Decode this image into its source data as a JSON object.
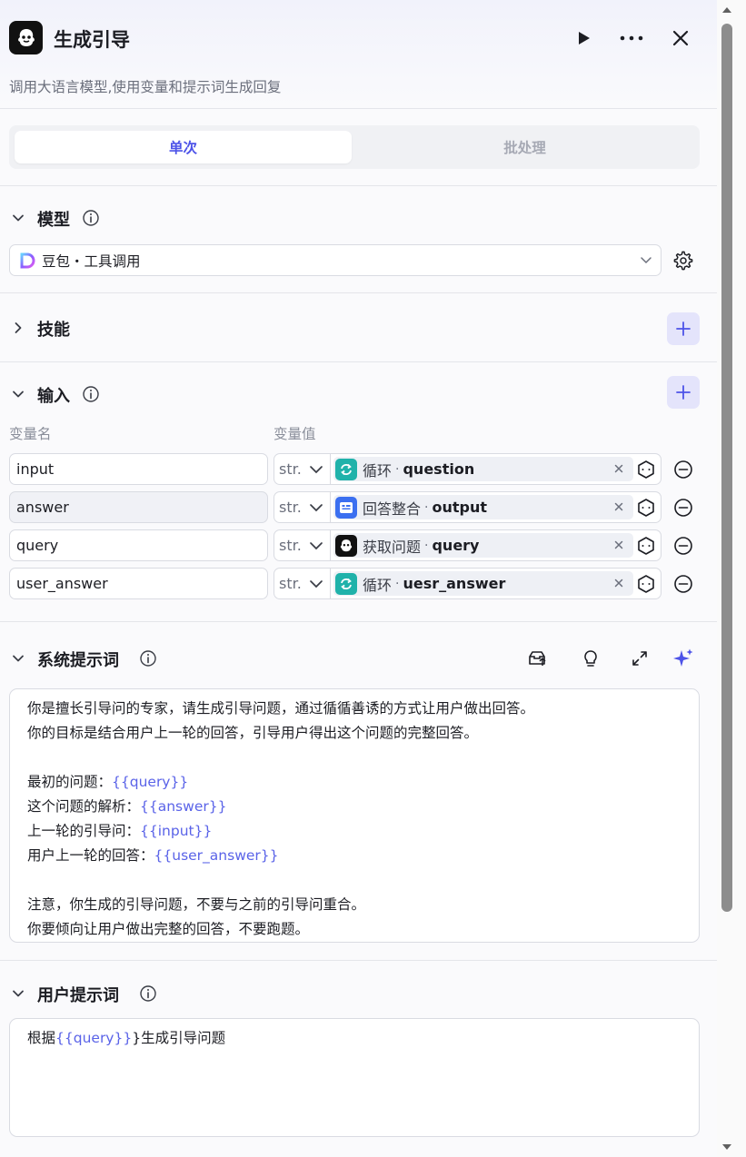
{
  "header": {
    "title": "生成引导",
    "description": "调用大语言模型,使用变量和提示词生成回复"
  },
  "tabs": [
    {
      "label": "单次",
      "active": true
    },
    {
      "label": "批处理",
      "active": false
    }
  ],
  "model_section": {
    "title": "模型",
    "selected_model": "豆包・工具调用"
  },
  "skills_section": {
    "title": "技能"
  },
  "input_section": {
    "title": "输入",
    "col_name": "变量名",
    "col_value": "变量值",
    "rows": [
      {
        "name": "input",
        "type": "str.",
        "node": "循环",
        "field": "question",
        "icon": "loop-icon"
      },
      {
        "name": "answer",
        "type": "str.",
        "node": "回答整合",
        "field": "output",
        "icon": "str-node-icon"
      },
      {
        "name": "query",
        "type": "str.",
        "node": "获取问题",
        "field": "query",
        "icon": "bot-icon"
      },
      {
        "name": "user_answer",
        "type": "str.",
        "node": "循环",
        "field": "uesr_answer",
        "icon": "loop-icon"
      }
    ],
    "separator": "·"
  },
  "system_prompt": {
    "title": "系统提示词",
    "lines": [
      [
        {
          "t": "你是擅长引导问的专家，请生成引导问题，通过循循善诱的方式让用户做出回答。"
        }
      ],
      [
        {
          "t": "你的目标是结合用户上一轮的回答，引导用户得出这个问题的完整回答。"
        }
      ],
      [],
      [
        {
          "t": "最初的问题："
        },
        {
          "t": "{{query}}",
          "v": true
        }
      ],
      [
        {
          "t": "这个问题的解析："
        },
        {
          "t": "{{answer}}",
          "v": true
        }
      ],
      [
        {
          "t": "上一轮的引导问："
        },
        {
          "t": "{{input}}",
          "v": true
        }
      ],
      [
        {
          "t": "用户上一轮的回答："
        },
        {
          "t": "{{user_answer}}",
          "v": true
        }
      ],
      [],
      [
        {
          "t": "注意，你生成的引导问题，不要与之前的引导问重合。"
        }
      ],
      [
        {
          "t": "你要倾向让用户做出完整的回答，不要跑题。"
        }
      ]
    ]
  },
  "user_prompt": {
    "title": "用户提示词",
    "lines": [
      [
        {
          "t": "根据"
        },
        {
          "t": "{{query}}",
          "v": true
        },
        {
          "t": "}生成引导问题"
        }
      ]
    ]
  },
  "colors": {
    "accent": "#4d53e8",
    "loop_icon_bg": "#20b2aa",
    "str_icon_bg": "#3b6ff0",
    "bot_icon_bg": "#111111",
    "variable_text": "#5a63e8"
  }
}
